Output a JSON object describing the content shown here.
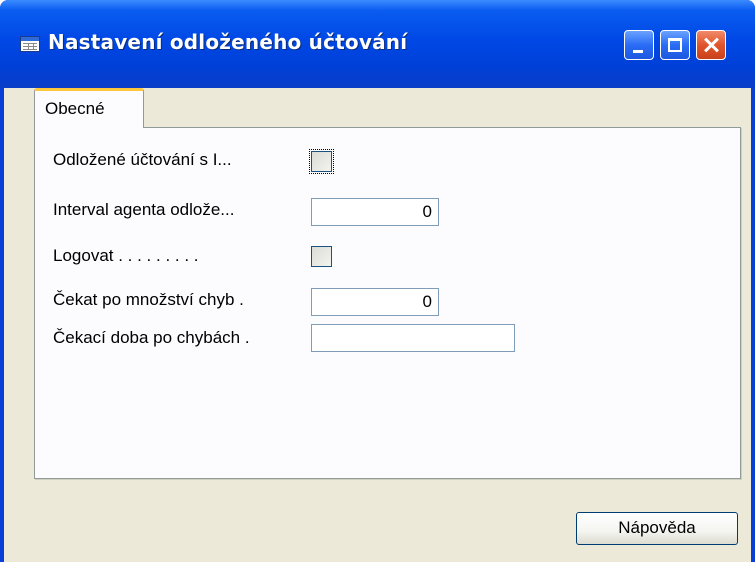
{
  "window": {
    "title": "Nastavení odloženého účtování",
    "icon": "form-icon",
    "controls": {
      "minimize": "minimize-icon",
      "maximize": "maximize-icon",
      "close": "close-icon"
    }
  },
  "tabs": [
    {
      "label": "Obecné",
      "active": true
    }
  ],
  "fields": {
    "deferred_posting": {
      "label": "Odložené účtování s I...",
      "checked": false
    },
    "agent_interval": {
      "label": "Interval agenta odlože...",
      "value": "0"
    },
    "log": {
      "label": "Logovat . . . . . . . . .",
      "checked": false
    },
    "wait_error_count": {
      "label": "Čekat po množství chyb .",
      "value": "0"
    },
    "wait_time": {
      "label": "Čekací doba po chybách .",
      "value": ""
    }
  },
  "buttons": {
    "help": "Nápověda"
  }
}
